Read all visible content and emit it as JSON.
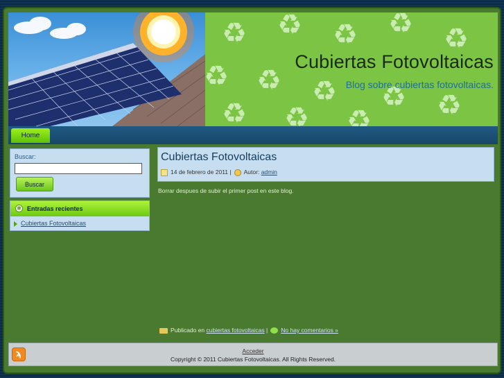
{
  "header": {
    "site_title": "Cubiertas Fotovoltaicas",
    "site_description": "Blog sobre cubiertas fotovoltaicas."
  },
  "nav": {
    "items": [
      {
        "label": "Home"
      }
    ]
  },
  "sidebar": {
    "search": {
      "label": "Buscar:",
      "value": "",
      "button_label": "Buscar"
    },
    "recent_posts": {
      "heading": "Entradas recientes",
      "items": [
        {
          "title": "Cubiertas Fotovoltaicas"
        }
      ]
    }
  },
  "post": {
    "title": "Cubiertas Fotovoltaicas",
    "date": "14 de febrero de 2011",
    "separator": "|",
    "author_label": "Autor:",
    "author": "admin",
    "body": "Borrar despues de subir el primer post en este blog.",
    "published_label": "Publicado en",
    "category": "cubiertas fotovoltaicas",
    "comments": "No hay comentarios »"
  },
  "footer": {
    "login": "Acceder",
    "copyright": "Copyright © 2011 Cubiertas Fotovoltaicas. All Rights Reserved."
  },
  "colors": {
    "page_green": "#4a7a2f",
    "header_green": "#7cc444",
    "nav_blue": "#1f5a84",
    "accent_lime": "#8ee82a"
  }
}
